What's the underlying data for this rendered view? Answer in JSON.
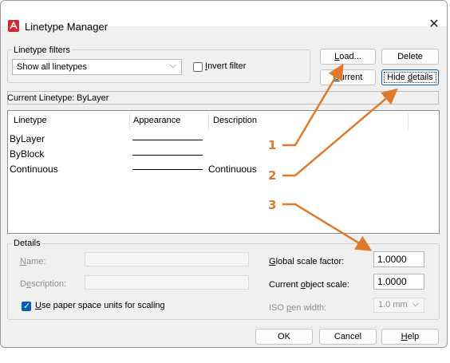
{
  "window": {
    "title": "Linetype Manager"
  },
  "filters": {
    "group_label": "Linetype filters",
    "selected": "Show all linetypes",
    "invert_label_u": "I",
    "invert_label_rest": "nvert filter"
  },
  "buttons": {
    "load_u": "L",
    "load_rest": "oad...",
    "delete": "Delete",
    "current_u": "C",
    "current_rest": "urrent",
    "hide_details_pre": "Hide ",
    "hide_details_u": "d",
    "hide_details_rest": "etails",
    "ok": "OK",
    "cancel": "Cancel",
    "help_u": "H",
    "help_rest": "elp"
  },
  "current_linetype": {
    "label": "Current Linetype:",
    "value": "ByLayer"
  },
  "list": {
    "columns": [
      "Linetype",
      "Appearance",
      "Description"
    ],
    "rows": [
      {
        "name": "ByLayer",
        "description": ""
      },
      {
        "name": "ByBlock",
        "description": ""
      },
      {
        "name": "Continuous",
        "description": "Continuous"
      }
    ]
  },
  "details": {
    "group_label": "Details",
    "name_label_u": "N",
    "name_label_rest": "ame:",
    "description_label_pre": "D",
    "description_label_u": "e",
    "description_label_rest": "scription:",
    "global_scale_label_u": "G",
    "global_scale_label_rest": "lobal scale factor:",
    "global_scale_value": "1.0000",
    "current_scale_label_pre": "Current ",
    "current_scale_label_u": "o",
    "current_scale_label_rest": "bject scale:",
    "current_scale_value": "1.0000",
    "paper_space_label_u": "U",
    "paper_space_label_rest": "se paper space units for scaling",
    "paper_space_checked": true,
    "iso_pen_label_pre": "ISO ",
    "iso_pen_label_u": "p",
    "iso_pen_label_rest": "en width:",
    "iso_pen_value": "1.0 mm"
  },
  "annotations": {
    "a1": "1",
    "a2": "2",
    "a3": "3"
  },
  "colors": {
    "accent": "#005fb8",
    "annotation": "#e07a2a",
    "app_icon": "#d7262e"
  }
}
